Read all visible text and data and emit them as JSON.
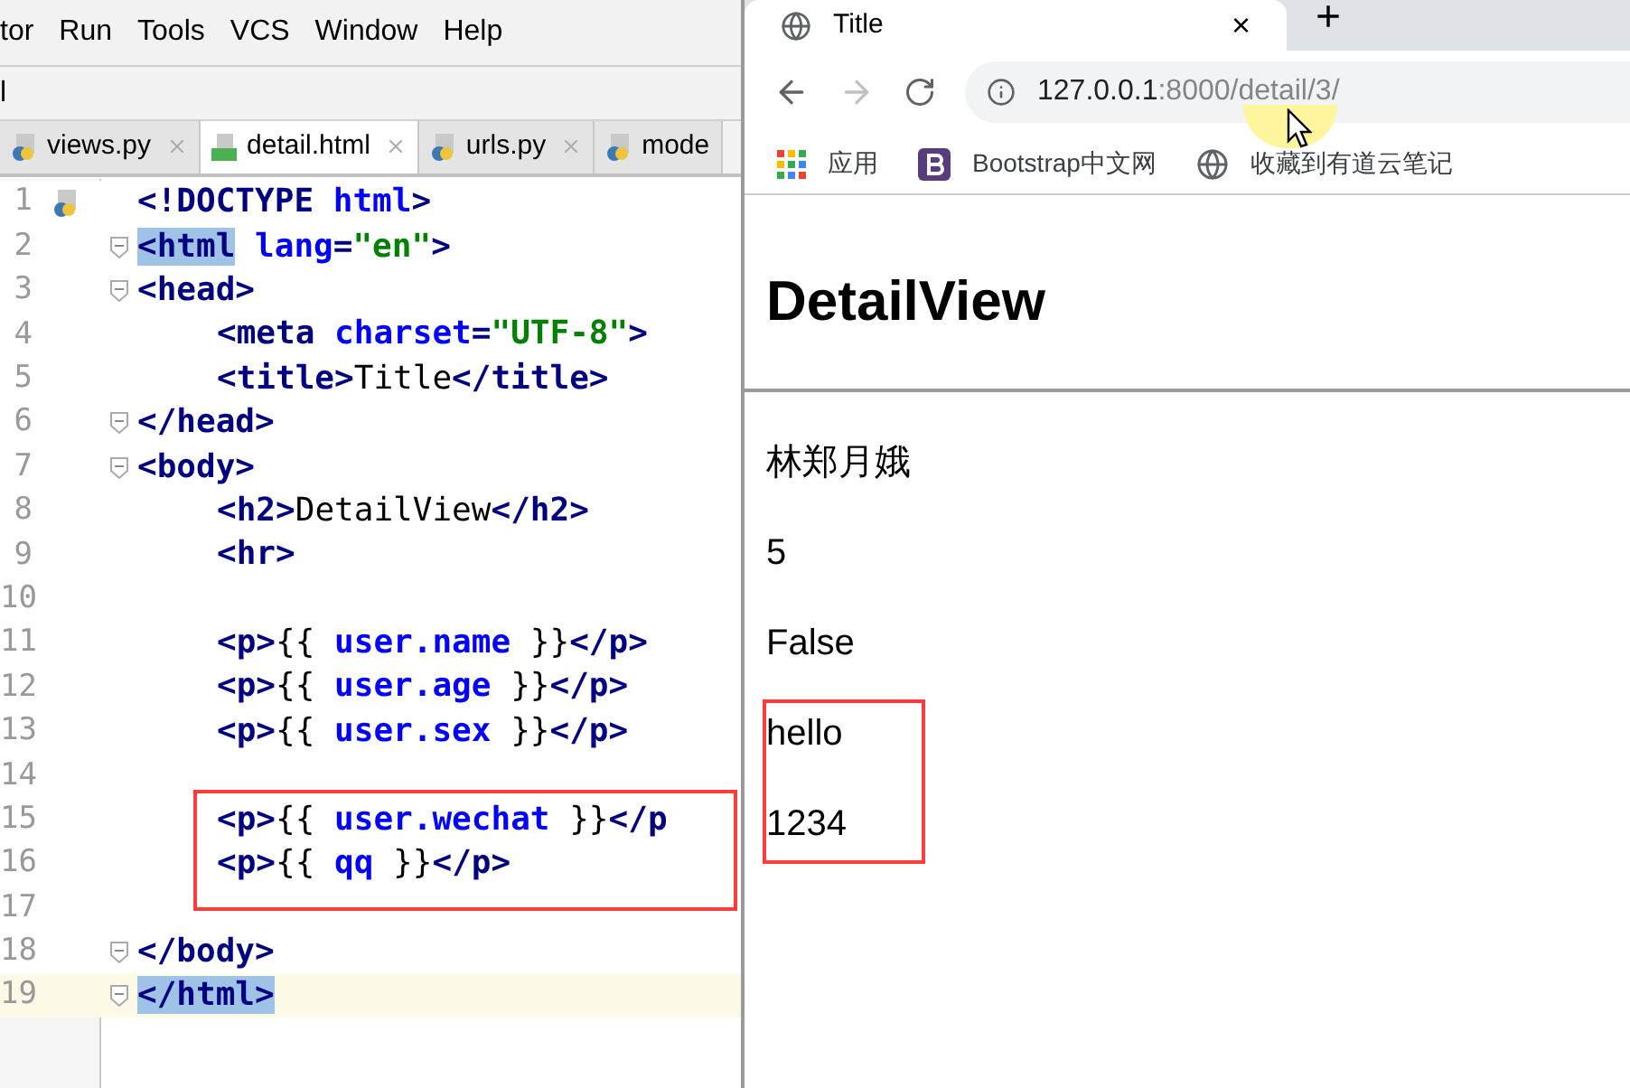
{
  "ide": {
    "menu": [
      "tor",
      "Run",
      "Tools",
      "VCS",
      "Window",
      "Help"
    ],
    "breadcrumb": "l",
    "tabs": [
      {
        "label": "views.py",
        "kind": "python",
        "selected": false,
        "closable": true
      },
      {
        "label": "detail.html",
        "kind": "html",
        "selected": true,
        "closable": true
      },
      {
        "label": "urls.py",
        "kind": "python",
        "selected": false,
        "closable": true
      },
      {
        "label": "mode",
        "kind": "python",
        "selected": false,
        "closable": false
      }
    ],
    "lines": [
      {
        "number": "1",
        "marker": true,
        "fold": false,
        "current": false,
        "indented": false,
        "segments": [
          {
            "kind": "tag",
            "text": "<!DOCTYPE "
          },
          {
            "kind": "attr",
            "text": "html"
          },
          {
            "kind": "tag",
            "text": ">"
          }
        ]
      },
      {
        "number": "2",
        "marker": false,
        "fold": true,
        "current": false,
        "indented": false,
        "segments": [
          {
            "kind": "match",
            "text": "<html"
          },
          {
            "kind": "attr",
            "text": " lang"
          },
          {
            "kind": "tag",
            "text": "="
          },
          {
            "kind": "string",
            "text": "\"en\""
          },
          {
            "kind": "tag",
            "text": ">"
          }
        ]
      },
      {
        "number": "3",
        "marker": false,
        "fold": true,
        "current": false,
        "indented": false,
        "segments": [
          {
            "kind": "tag",
            "text": "<head>"
          }
        ]
      },
      {
        "number": "4",
        "marker": false,
        "fold": false,
        "current": false,
        "indented": true,
        "segments": [
          {
            "kind": "tag",
            "text": "<meta "
          },
          {
            "kind": "attr",
            "text": "charset"
          },
          {
            "kind": "tag",
            "text": "="
          },
          {
            "kind": "string",
            "text": "\"UTF-8\""
          },
          {
            "kind": "tag",
            "text": ">"
          }
        ]
      },
      {
        "number": "5",
        "marker": false,
        "fold": false,
        "current": false,
        "indented": true,
        "segments": [
          {
            "kind": "tag",
            "text": "<title>"
          },
          {
            "kind": "text",
            "text": "Title"
          },
          {
            "kind": "tag",
            "text": "</title>"
          }
        ]
      },
      {
        "number": "6",
        "marker": false,
        "fold": true,
        "current": false,
        "indented": false,
        "segments": [
          {
            "kind": "tag",
            "text": "</head>"
          }
        ]
      },
      {
        "number": "7",
        "marker": false,
        "fold": true,
        "current": false,
        "indented": false,
        "segments": [
          {
            "kind": "tag",
            "text": "<body>"
          }
        ]
      },
      {
        "number": "8",
        "marker": false,
        "fold": false,
        "current": false,
        "indented": true,
        "segments": [
          {
            "kind": "tag",
            "text": "<h2>"
          },
          {
            "kind": "text",
            "text": "DetailView"
          },
          {
            "kind": "tag",
            "text": "</h2>"
          }
        ]
      },
      {
        "number": "9",
        "marker": false,
        "fold": false,
        "current": false,
        "indented": true,
        "segments": [
          {
            "kind": "tag",
            "text": "<hr>"
          }
        ]
      },
      {
        "number": "10",
        "marker": false,
        "fold": false,
        "current": false
      },
      {
        "number": "11",
        "marker": false,
        "fold": false,
        "current": false,
        "indented": true,
        "segments": [
          {
            "kind": "tag",
            "text": "<p>"
          },
          {
            "kind": "text",
            "text": "{{ "
          },
          {
            "kind": "attr",
            "text": "user.name"
          },
          {
            "kind": "text",
            "text": " }}"
          },
          {
            "kind": "tag",
            "text": "</p>"
          }
        ]
      },
      {
        "number": "12",
        "marker": false,
        "fold": false,
        "current": false,
        "indented": true,
        "segments": [
          {
            "kind": "tag",
            "text": "<p>"
          },
          {
            "kind": "text",
            "text": "{{ "
          },
          {
            "kind": "attr",
            "text": "user.age"
          },
          {
            "kind": "text",
            "text": " }}"
          },
          {
            "kind": "tag",
            "text": "</p>"
          }
        ]
      },
      {
        "number": "13",
        "marker": false,
        "fold": false,
        "current": false,
        "indented": true,
        "segments": [
          {
            "kind": "tag",
            "text": "<p>"
          },
          {
            "kind": "text",
            "text": "{{ "
          },
          {
            "kind": "attr",
            "text": "user.sex"
          },
          {
            "kind": "text",
            "text": " }}"
          },
          {
            "kind": "tag",
            "text": "</p>"
          }
        ]
      },
      {
        "number": "14",
        "marker": false,
        "fold": false,
        "current": false
      },
      {
        "number": "15",
        "marker": false,
        "fold": false,
        "current": false,
        "indented": true,
        "segments": [
          {
            "kind": "tag",
            "text": "<p>"
          },
          {
            "kind": "text",
            "text": "{{ "
          },
          {
            "kind": "attr",
            "text": "user.wechat"
          },
          {
            "kind": "text",
            "text": " }}"
          },
          {
            "kind": "tag",
            "text": "</p"
          }
        ]
      },
      {
        "number": "16",
        "marker": false,
        "fold": false,
        "current": false,
        "indented": true,
        "segments": [
          {
            "kind": "tag",
            "text": "<p>"
          },
          {
            "kind": "text",
            "text": "{{ "
          },
          {
            "kind": "attr",
            "text": "qq"
          },
          {
            "kind": "text",
            "text": " }}"
          },
          {
            "kind": "tag",
            "text": "</p>"
          }
        ]
      },
      {
        "number": "17",
        "marker": false,
        "fold": false,
        "current": false
      },
      {
        "number": "18",
        "marker": false,
        "fold": true,
        "current": false,
        "indented": false,
        "segments": [
          {
            "kind": "tag",
            "text": "</body>"
          }
        ]
      },
      {
        "number": "19",
        "marker": false,
        "fold": true,
        "current": true,
        "indented": false,
        "segments": [
          {
            "kind": "match",
            "text": "</html>"
          }
        ]
      }
    ]
  },
  "browser": {
    "tab": {
      "title": "Title",
      "close": "×"
    },
    "new_tab": "+",
    "address": {
      "host": "127.0.0.1",
      "path": ":8000/detail/3/"
    },
    "bookmarks": [
      {
        "kind": "apps",
        "label": "应用"
      },
      {
        "kind": "bootstrap",
        "label": "Bootstrap中文网"
      },
      {
        "kind": "globe",
        "label": "收藏到有道云笔记"
      }
    ],
    "page": {
      "heading": "DetailView",
      "paragraphs": [
        "林郑月娥",
        "5",
        "False",
        "hello",
        "1234"
      ]
    }
  }
}
